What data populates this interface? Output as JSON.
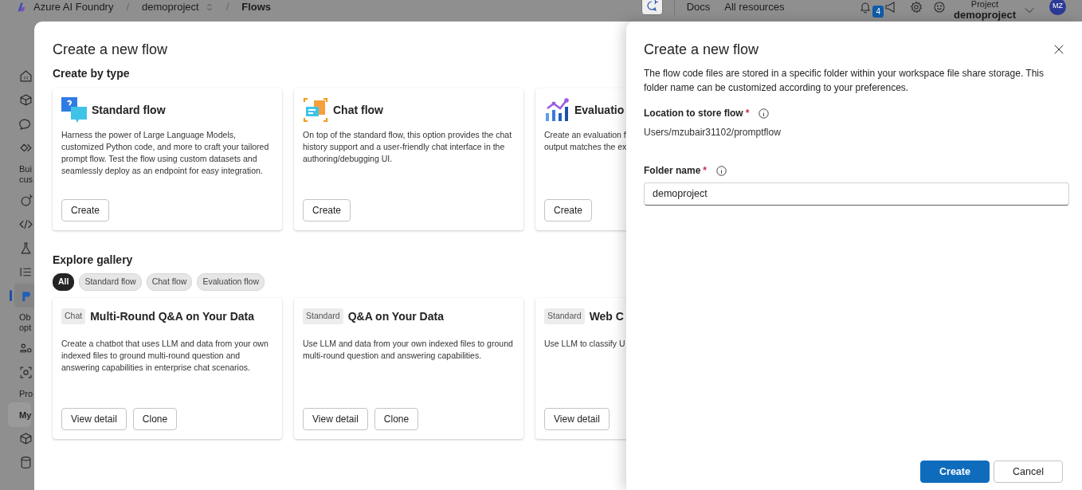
{
  "top_bar": {
    "app_name": "Azure AI Foundry",
    "separator_1": "/",
    "project": "demoproject",
    "separator_2": "/",
    "page": "Flows",
    "links": [
      "Docs",
      "All resources"
    ],
    "notification_count": "4",
    "project_label": "Project",
    "project_name": "demoproject",
    "avatar": "MZ"
  },
  "sidebar": {
    "items": [
      {
        "kind": "icon",
        "selected": false
      },
      {
        "kind": "icon",
        "selected": false
      },
      {
        "kind": "icon",
        "selected": false
      },
      {
        "kind": "icon",
        "selected": false
      },
      {
        "kind": "label",
        "lines": [
          "Bui",
          "cus"
        ]
      },
      {
        "kind": "icon",
        "selected": false
      },
      {
        "kind": "icon",
        "selected": false
      },
      {
        "kind": "icon",
        "selected": false
      },
      {
        "kind": "icon",
        "selected": false
      },
      {
        "kind": "icon",
        "selected": true
      },
      {
        "kind": "label",
        "lines": [
          "Ob",
          "opt"
        ]
      },
      {
        "kind": "icon",
        "selected": false
      },
      {
        "kind": "icon",
        "selected": false
      },
      {
        "kind": "label",
        "lines": [
          "Pro"
        ]
      },
      {
        "kind": "section",
        "lines": [
          "My"
        ]
      },
      {
        "kind": "icon",
        "selected": false
      },
      {
        "kind": "icon",
        "selected": false
      }
    ]
  },
  "modal": {
    "title": "Create a new flow",
    "create_section": {
      "heading": "Create by type",
      "cards": [
        {
          "title": "Standard flow",
          "description": "Harness the power of Large Language Models, customized Python code, and more to craft your tailored prompt flow. Test the flow using custom datasets and seamlessly deploy as an endpoint for easy integration.",
          "button": "Create"
        },
        {
          "title": "Chat flow",
          "description": "On top of the standard flow, this option provides the chat history support and a user-friendly chat interface in the authoring/debugging UI.",
          "button": "Create"
        },
        {
          "title": "Evaluatio",
          "description": "Create an evaluation f\noutput matches the ex",
          "button": "Create"
        }
      ]
    },
    "gallery": {
      "heading": "Explore gallery",
      "filters": [
        {
          "label": "All",
          "selected": true
        },
        {
          "label": "Standard flow",
          "selected": false
        },
        {
          "label": "Chat flow",
          "selected": false
        },
        {
          "label": "Evaluation flow",
          "selected": false
        }
      ],
      "cards": [
        {
          "tag": "Chat",
          "title": "Multi-Round Q&A on Your Data",
          "description": "Create a chatbot that uses LLM and data from your own indexed files to ground multi-round question and answering capabilities in enterprise chat scenarios.",
          "buttons": [
            "View detail",
            "Clone"
          ]
        },
        {
          "tag": "Standard",
          "title": "Q&A on Your Data",
          "description": "Use LLM and data from your own indexed files to ground multi-round question and answering capabilities.",
          "buttons": [
            "View detail",
            "Clone"
          ]
        },
        {
          "tag": "Standard",
          "title": "Web C",
          "description": "Use LLM to classify U",
          "buttons": [
            "View detail"
          ]
        }
      ]
    }
  },
  "panel": {
    "title": "Create a new flow",
    "description": "The flow code files are stored in a specific folder within your workspace file share storage. This folder name can be customized according to your preferences.",
    "fields": [
      {
        "kind": "text",
        "label": "Location to store flow",
        "required_mark": "*",
        "value": "Users/mzubair31102/promptflow"
      },
      {
        "kind": "input",
        "label": "Folder name",
        "required_mark": "*",
        "value": "demoproject"
      }
    ],
    "buttons": [
      {
        "label": "Create",
        "kind": "primary"
      },
      {
        "label": "Cancel",
        "kind": "secondary"
      }
    ]
  }
}
